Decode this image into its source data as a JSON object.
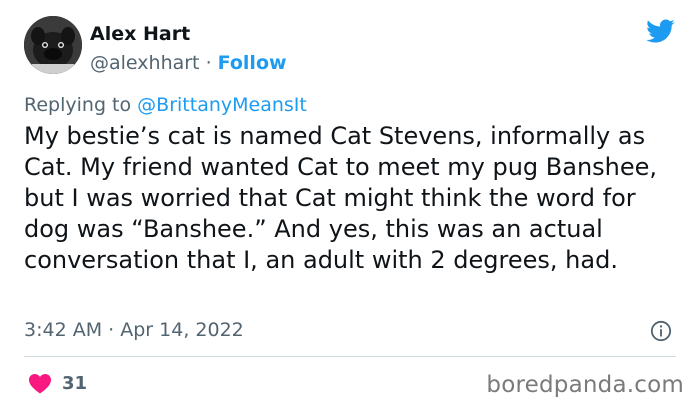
{
  "author": {
    "name": "Alex Hart",
    "handle": "@alexhhart",
    "separator": "·",
    "follow_label": "Follow"
  },
  "reply": {
    "prefix": "Replying to",
    "mention": "@BrittanyMeansIt"
  },
  "tweet": {
    "text": "My bestie’s cat is named Cat Stevens, informally as Cat. My friend wanted Cat to meet my pug Banshee, but I was worried that Cat might think the word for dog was “Banshee.” And yes, this was an actual conversation that I, an adult with 2 degrees, had.",
    "time": "3:42 AM",
    "separator": "·",
    "date": "Apr 14, 2022"
  },
  "stats": {
    "likes": "31"
  },
  "watermark": "boredpanda.com",
  "colors": {
    "accent": "#1d9bf0",
    "like": "#f91880",
    "muted": "#536471"
  },
  "icons": {
    "brand": "twitter-bird-icon",
    "info": "info-icon",
    "like": "heart-icon"
  }
}
